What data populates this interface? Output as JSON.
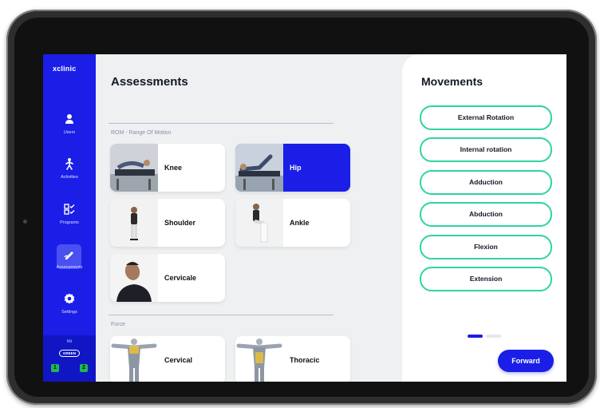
{
  "app": {
    "brand": "xclinic"
  },
  "sidebar": {
    "items": [
      {
        "label": "Users",
        "icon": "user-icon"
      },
      {
        "label": "Activities",
        "icon": "activities-icon"
      },
      {
        "label": "Programs",
        "icon": "programs-icon"
      },
      {
        "label": "Assessments",
        "icon": "assessments-icon",
        "active": true
      },
      {
        "label": "Settings",
        "icon": "gear-icon"
      }
    ],
    "kit": {
      "title": "Kit",
      "badge": "GREEN",
      "devices": [
        "1",
        "2"
      ]
    }
  },
  "main": {
    "title": "Assessments",
    "sections": [
      {
        "title": "ROM - Range Of Motion",
        "cards": [
          {
            "label": "Knee",
            "selected": false
          },
          {
            "label": "Hip",
            "selected": true
          },
          {
            "label": "Shoulder",
            "selected": false
          },
          {
            "label": "Ankle",
            "selected": false
          },
          {
            "label": "Cervicale",
            "selected": false
          }
        ]
      },
      {
        "title": "Force",
        "cards": [
          {
            "label": "Cervical",
            "selected": false
          },
          {
            "label": "Thoracic",
            "selected": false
          }
        ]
      }
    ]
  },
  "movements": {
    "title": "Movements",
    "items": [
      "External Rotation",
      "Internal rotation",
      "Adduction",
      "Abduction",
      "Flexion",
      "Extension"
    ],
    "page": {
      "current": 1,
      "total": 2
    },
    "forward_label": "Forward"
  },
  "colors": {
    "primary": "#1a1ee6",
    "accent": "#2dd4a3",
    "kit_green": "#1db954",
    "background": "#eef0f2"
  }
}
